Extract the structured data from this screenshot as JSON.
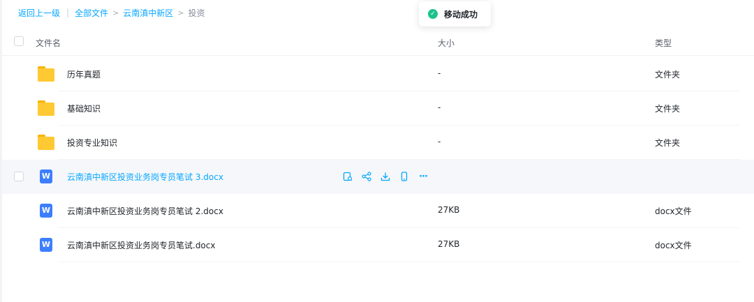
{
  "breadcrumb": {
    "back": "返回上一级",
    "sep": "|",
    "items": [
      "全部文件",
      "云南滇中新区"
    ],
    "arrow": ">",
    "current": "投资"
  },
  "toast": {
    "message": "移动成功",
    "check": "✓",
    "icon": "check-circle-icon",
    "color": "#1cc28d"
  },
  "table": {
    "headers": {
      "name": "文件名",
      "size": "大小",
      "type": "类型"
    },
    "rows": [
      {
        "icon": "folder-icon",
        "name": "历年真题",
        "size": "-",
        "type": "文件夹"
      },
      {
        "icon": "folder-icon",
        "name": "基础知识",
        "size": "-",
        "type": "文件夹"
      },
      {
        "icon": "folder-icon",
        "name": "投资专业知识",
        "size": "-",
        "type": "文件夹"
      },
      {
        "icon": "word-doc-icon",
        "name": "云南滇中新区投资业务岗专员笔试 3.docx",
        "size": "",
        "type": "",
        "hovered": true
      },
      {
        "icon": "word-doc-icon",
        "name": "云南滇中新区投资业务岗专员笔试 2.docx",
        "size": "27KB",
        "type": "docx文件"
      },
      {
        "icon": "word-doc-icon",
        "name": "云南滇中新区投资业务岗专员笔试.docx",
        "size": "27KB",
        "type": "docx文件"
      }
    ],
    "doc_letter": "W",
    "more": "···"
  },
  "colors": {
    "accent": "#06a7ff",
    "folder": "#ffc933",
    "doc": "#3d7efe"
  }
}
